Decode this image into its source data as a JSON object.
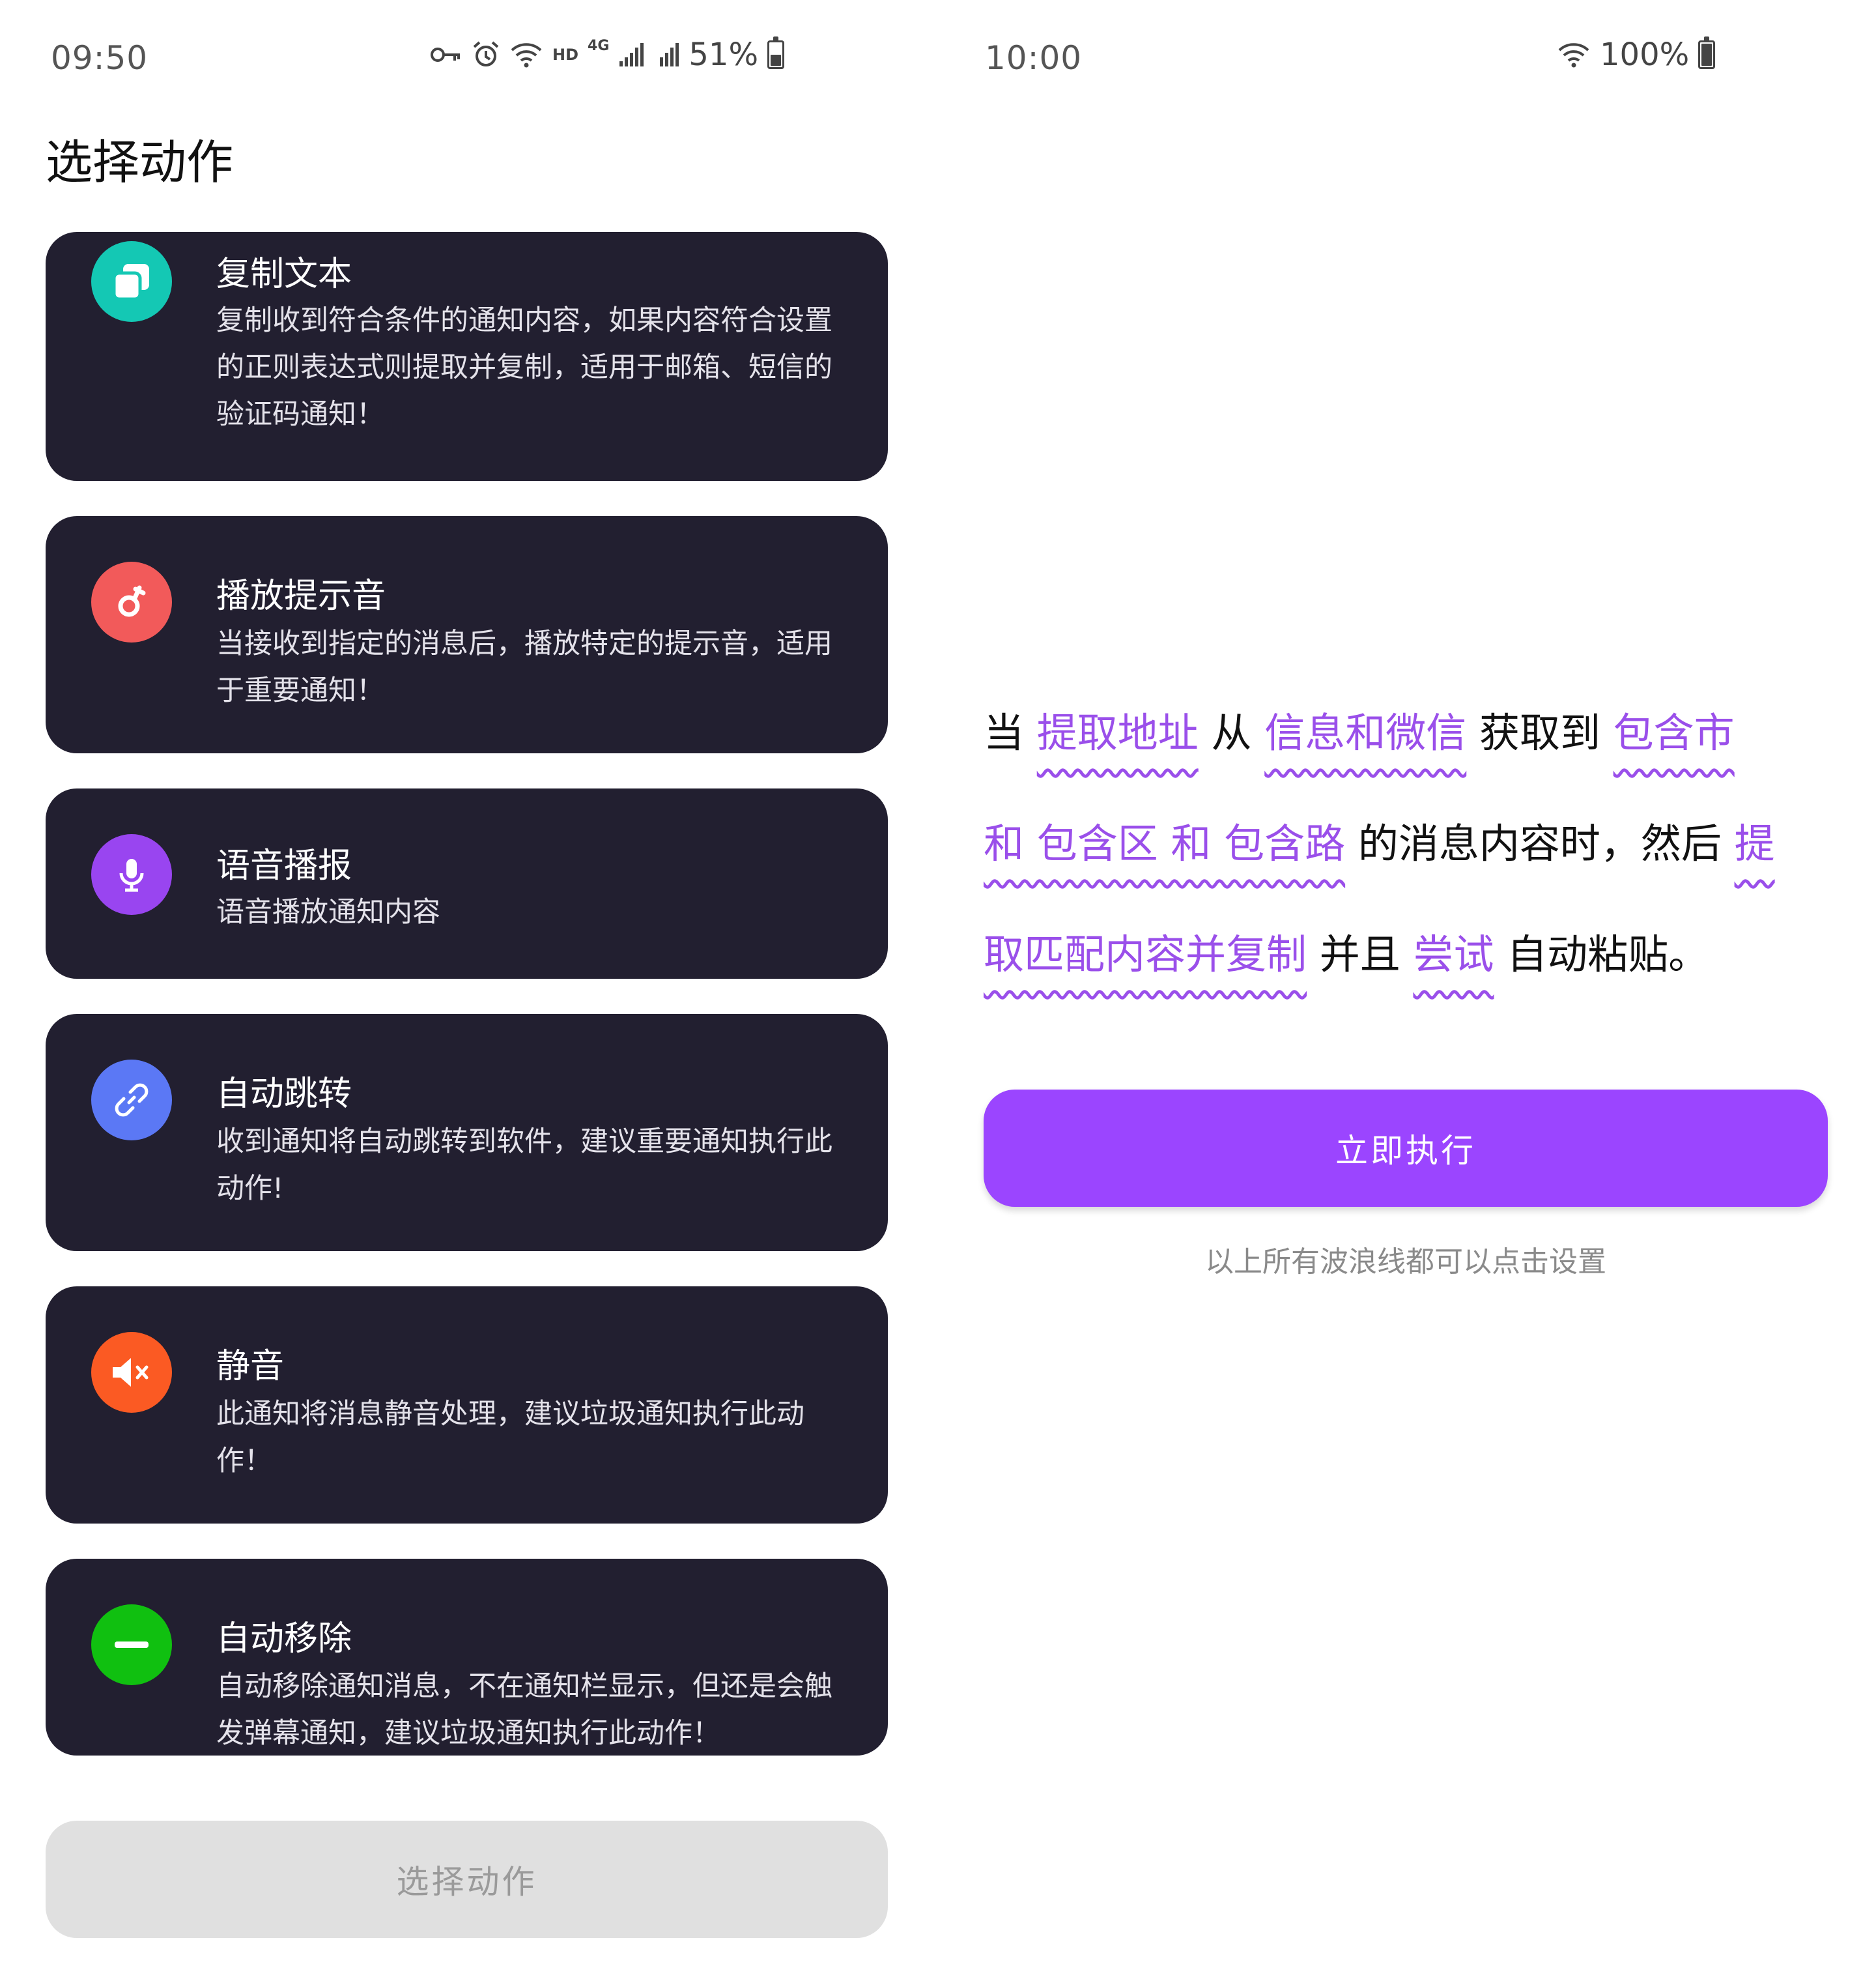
{
  "left": {
    "status_bar": {
      "time": "09:50",
      "icons": [
        "key-icon",
        "alarm-icon",
        "wifi-icon",
        "hd-icon",
        "4g-icon",
        "signal-icon",
        "4g-signal-icon"
      ],
      "hd_label": "HD",
      "net_label": "4G",
      "battery": "51%",
      "battery_level": 0.51
    },
    "title": "选择动作",
    "actions": [
      {
        "title": "复制文本",
        "desc": "复制收到符合条件的通知内容，如果内容符合设置的正则表达式则提取并复制，适用于邮箱、短信的验证码通知！",
        "icon": "copy-icon",
        "color": "#14c8b4"
      },
      {
        "title": "播放提示音",
        "desc": "当接收到指定的消息后，播放特定的提示音，适用于重要通知！",
        "icon": "music-icon",
        "color": "#f25a5a"
      },
      {
        "title": "语音播报",
        "desc": "语音播放通知内容",
        "icon": "microphone-icon",
        "color": "#9945f0"
      },
      {
        "title": "自动跳转",
        "desc": "收到通知将自动跳转到软件，建议重要通知执行此动作!",
        "icon": "link-icon",
        "color": "#5b78f5"
      },
      {
        "title": "静音",
        "desc": "此通知将消息静音处理，建议垃圾通知执行此动作！",
        "icon": "mute-icon",
        "color": "#fb5a23"
      },
      {
        "title": "自动移除",
        "desc": "自动移除通知消息，不在通知栏显示，但还是会触发弹幕通知，建议垃圾通知执行此动作！",
        "icon": "remove-icon",
        "color": "#10c010"
      }
    ],
    "select_button": "选择动作"
  },
  "right": {
    "status_bar": {
      "time": "10:00",
      "icons": [
        "wifi-icon"
      ],
      "battery": "100%",
      "battery_level": 1.0
    },
    "sentence": {
      "l1_a": "当",
      "l1_link1": "提取地址",
      "l1_b": "从",
      "l1_link2": "信息和微信",
      "l1_c": "获取到",
      "l1_link3": "包含市",
      "l2_link1": "和 包含区 和 包含路",
      "l2_a": "的消息内容时，然后",
      "l2_link2": "提",
      "l3_link1": "取匹配内容并复制",
      "l3_a": "并且",
      "l3_link2": "尝试",
      "l3_b": "自动粘贴。"
    },
    "execute_button": "立即执行",
    "hint": "以上所有波浪线都可以点击设置",
    "accent": "#9b45ff"
  }
}
